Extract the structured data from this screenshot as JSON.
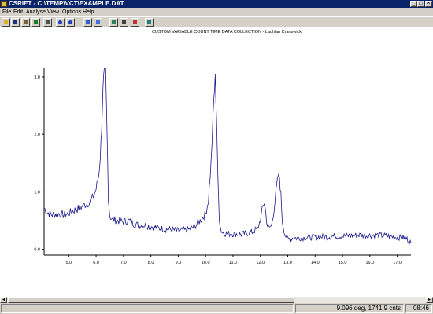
{
  "window": {
    "title": "CSRIET - C:\\TEMP\\VCT\\EXAMPLE.DAT"
  },
  "menu": [
    "File",
    "Edit",
    "Analyse",
    "View",
    "Options",
    "Help"
  ],
  "toolbar": {
    "icons": [
      "open-folder-icon",
      "save-icon",
      "pencil-icon",
      "run-icon",
      "print-icon",
      "zoom-in-icon",
      "zoom-out-icon",
      "peak-search-icon",
      "pattern-icon",
      "data-view-icon",
      "camera-icon",
      "delete-icon",
      "export-icon"
    ]
  },
  "chart_data": {
    "type": "line",
    "title": "CUSTOM VARIABLE COUNT TIME DATA COLLECTION - Lachlan Cranswick",
    "xlabel": "",
    "ylabel": "",
    "xlim": [
      4.1,
      17.5
    ],
    "ylim": [
      -0.1,
      3.15
    ],
    "x_ticks": [
      "5.0",
      "6.0",
      "7.0",
      "8.0",
      "9.0",
      "10.0",
      "11.0",
      "12.0",
      "13.0",
      "14.0",
      "15.0",
      "16.0",
      "17.0"
    ],
    "y_ticks": [
      "0.0",
      "1.0",
      "2.0",
      "3.0"
    ],
    "grid": false,
    "line_color": "#1a1a8c",
    "series": [
      {
        "x": [
          4.1,
          4.2,
          4.4,
          4.6,
          4.8,
          5.0,
          5.2,
          5.4,
          5.6,
          5.7,
          5.8,
          5.9,
          6.0,
          6.1,
          6.15,
          6.2,
          6.25,
          6.3,
          6.35,
          6.4,
          6.45,
          6.5,
          6.6,
          6.8,
          7.0,
          7.2,
          7.4,
          7.6,
          7.8,
          8.0,
          8.2,
          8.4,
          8.6,
          8.8,
          9.0,
          9.2,
          9.4,
          9.6,
          9.8,
          10.0,
          10.1,
          10.2,
          10.3,
          10.35,
          10.4,
          10.45,
          10.5,
          10.55,
          10.6,
          10.7,
          10.9,
          11.1,
          11.3,
          11.5,
          11.7,
          11.9,
          12.0,
          12.1,
          12.15,
          12.2,
          12.25,
          12.3,
          12.4,
          12.5,
          12.6,
          12.65,
          12.7,
          12.75,
          12.8,
          12.9,
          13.0,
          13.2,
          13.5,
          13.8,
          14.1,
          14.4,
          14.7,
          15.0,
          15.3,
          15.6,
          15.9,
          16.2,
          16.5,
          16.8,
          17.1,
          17.3,
          17.5
        ],
        "y": [
          0.72,
          0.65,
          0.6,
          0.62,
          0.6,
          0.63,
          0.68,
          0.72,
          0.78,
          0.8,
          0.85,
          0.92,
          1.05,
          1.3,
          1.6,
          2.1,
          2.75,
          3.15,
          3.1,
          2.0,
          0.9,
          0.58,
          0.52,
          0.5,
          0.48,
          0.5,
          0.44,
          0.42,
          0.42,
          0.4,
          0.38,
          0.36,
          0.35,
          0.34,
          0.32,
          0.33,
          0.35,
          0.4,
          0.5,
          0.62,
          0.85,
          1.5,
          2.6,
          2.98,
          2.3,
          1.2,
          0.55,
          0.36,
          0.3,
          0.28,
          0.27,
          0.27,
          0.26,
          0.28,
          0.3,
          0.36,
          0.52,
          0.75,
          0.82,
          0.62,
          0.42,
          0.38,
          0.4,
          0.7,
          1.1,
          1.28,
          1.24,
          0.95,
          0.5,
          0.25,
          0.18,
          0.2,
          0.2,
          0.21,
          0.22,
          0.22,
          0.23,
          0.23,
          0.24,
          0.25,
          0.24,
          0.25,
          0.24,
          0.22,
          0.21,
          0.2,
          0.12
        ]
      }
    ]
  },
  "statusbar": {
    "readout": "9.096 deg, 1741.9 cnts",
    "time": "08:46"
  }
}
